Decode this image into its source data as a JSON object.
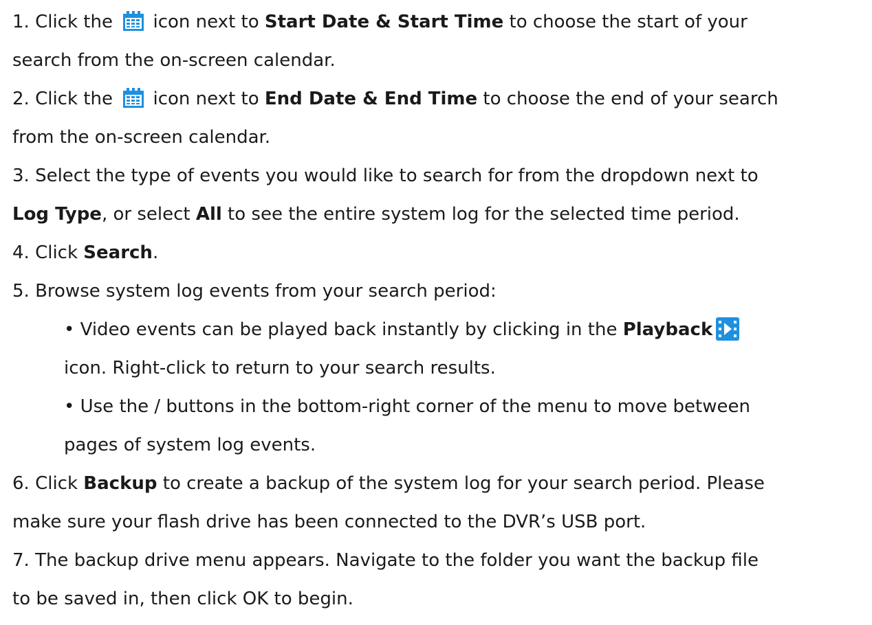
{
  "steps": {
    "s1": {
      "pre": "1. Click the ",
      "mid": " icon next to ",
      "bold": "Start Date & Start Time",
      "post": " to choose the start of your",
      "cont": "search from the on-screen calendar."
    },
    "s2": {
      "pre": "2. Click the ",
      "mid": " icon next to ",
      "bold": "End Date & End Time",
      "post": " to choose the end of your search",
      "cont": "from the on-screen calendar."
    },
    "s3": {
      "line1": "3. Select the type of events you would like to search for from the dropdown next to",
      "bold1": "Log Type",
      "mid": ", or select ",
      "bold2": "All",
      "post": " to see the entire system log for the selected time period."
    },
    "s4": {
      "pre": "4. Click ",
      "bold": "Search",
      "post": "."
    },
    "s5": {
      "text": "5. Browse system log events from your search period:",
      "b1_pre": "• Video events can be played back instantly by clicking in the ",
      "b1_bold": "Playback",
      "b1_cont": "icon. Right-click to return to your search results.",
      "b2_line1": "• Use the / buttons in the bottom-right corner of the menu to move between",
      "b2_line2": "pages of system log events."
    },
    "s6": {
      "pre": "6. Click ",
      "bold": "Backup",
      "post": " to create a backup of the system log for your search period. Please",
      "cont": "make sure your flash drive has been connected to the DVR’s USB port."
    },
    "s7": {
      "line1": "7. The backup drive menu appears. Navigate to the folder you want the backup file",
      "line2": "to be saved in, then click OK to begin."
    }
  },
  "icons": {
    "calendar": "calendar-icon",
    "playback": "playback-icon"
  },
  "colors": {
    "icon_blue": "#1e90e0",
    "text": "#1a1a1a"
  }
}
